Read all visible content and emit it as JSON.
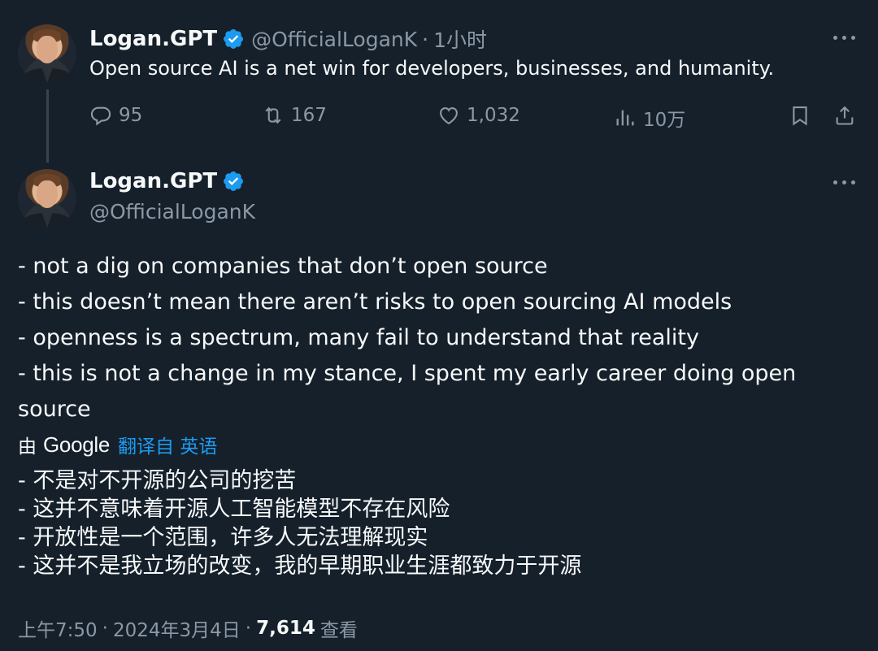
{
  "tweet1": {
    "display_name": "Logan.GPT",
    "handle": "@OfficialLoganK",
    "separator": "·",
    "time_ago": "1小时",
    "text": "Open source AI is a net win for developers,  businesses, and humanity.",
    "actions": {
      "replies": "95",
      "retweets": "167",
      "likes": "1,032",
      "views": "10万"
    }
  },
  "tweet2": {
    "display_name": "Logan.GPT",
    "handle": "@OfficialLoganK",
    "lines": [
      "- not a dig on companies that don’t open source",
      "- this doesn’t mean there aren’t risks to open sourcing AI models",
      "- openness is a spectrum, many fail to understand that reality",
      "- this is not a change in my stance, I spent my early career doing open",
      "source"
    ],
    "translation": {
      "by_label": "由",
      "provider": "Google",
      "link_text": "翻译自 英语",
      "lines": [
        "- 不是对不开源的公司的挖苦",
        "- 这并不意味着开源人工智能模型不存在风险",
        "- 开放性是一个范围，许多人无法理解现实",
        "- 这并不是我立场的改变，我的早期职业生涯都致力于开源"
      ]
    },
    "meta": {
      "time": "上午7:50",
      "sep1": "·",
      "date": "2024年3月4日",
      "sep2": "·",
      "views_count": "7,614",
      "views_label": "查看"
    }
  },
  "colors": {
    "background": "#15202b",
    "text": "#f7f9f9",
    "secondary": "#8b98a5",
    "accent": "#1d9bf0"
  },
  "icons": [
    "verified-badge-icon",
    "more-icon",
    "reply-icon",
    "retweet-icon",
    "like-icon",
    "views-icon",
    "bookmark-icon",
    "share-icon"
  ]
}
